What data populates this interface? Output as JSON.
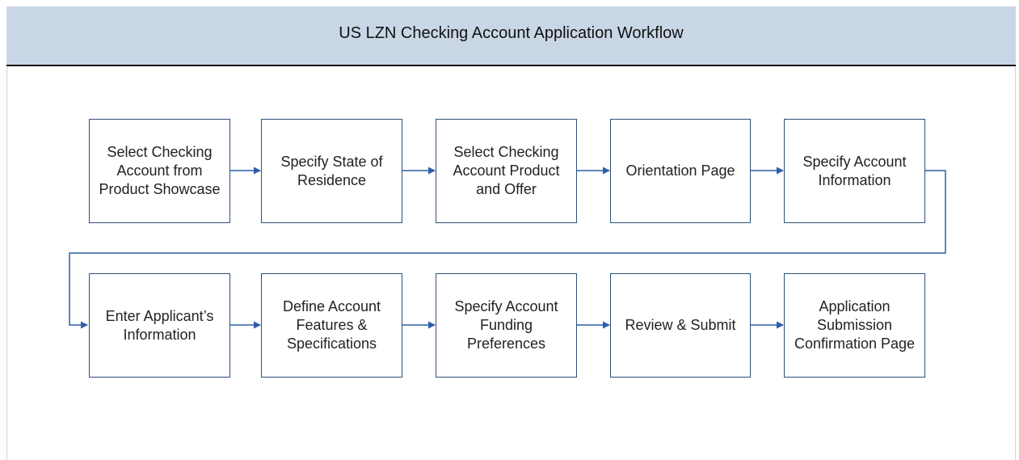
{
  "header": {
    "title": "US LZN Checking Account Application Workflow"
  },
  "colors": {
    "header_bg": "#c9d6e6",
    "box_border": "#2e4f7a",
    "arrow": "#2f5da8"
  },
  "steps": [
    {
      "label": "Select Checking Account from Product Showcase"
    },
    {
      "label": "Specify State of Residence"
    },
    {
      "label": "Select Checking Account Product and Offer"
    },
    {
      "label": "Orientation Page"
    },
    {
      "label": "Specify Account Information"
    },
    {
      "label": "Enter Applicant’s Information"
    },
    {
      "label": "Define Account Features & Specifications"
    },
    {
      "label": "Specify Account Funding Preferences"
    },
    {
      "label": "Review & Submit"
    },
    {
      "label": "Application Submission Confirmation Page"
    }
  ]
}
